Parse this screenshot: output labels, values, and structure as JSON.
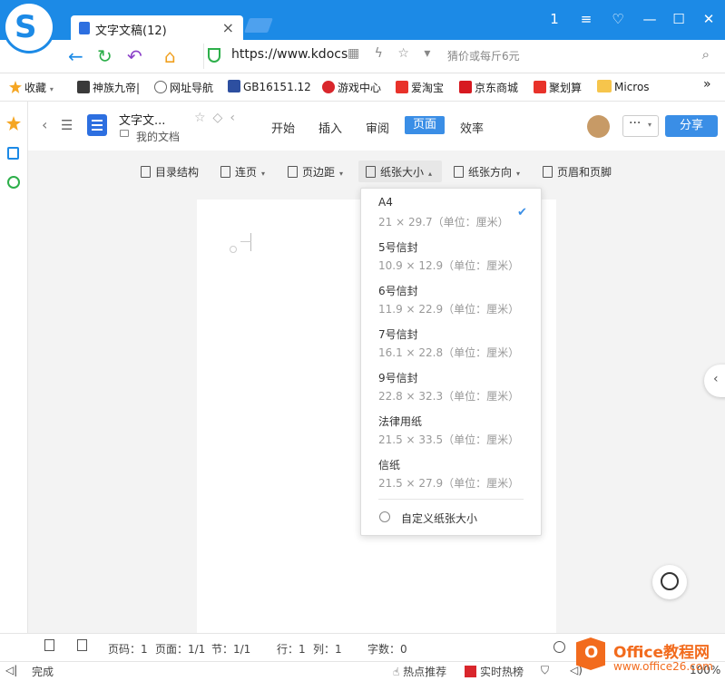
{
  "browser": {
    "tab_title": "文字文稿(12)",
    "tab_close": "×",
    "url": "https://www.kdocs",
    "search_placeholder": "猜价或每斤6元",
    "window_controls": [
      "1",
      "≡",
      "♡",
      "—",
      "☐",
      "✕"
    ],
    "nav_icons": [
      "back-icon",
      "refresh-icon",
      "undo-icon",
      "home-icon"
    ]
  },
  "bookmarks": [
    {
      "label": "收藏",
      "icon": "star-icon",
      "color": "#f5a623"
    },
    {
      "label": "神族九帝|",
      "icon": "game-icon",
      "color": "#3a3a3a"
    },
    {
      "label": "网址导航",
      "icon": "globe-icon",
      "color": "#666666"
    },
    {
      "label": "GB16151.12",
      "icon": "a-icon",
      "color": "#2d4fa0"
    },
    {
      "label": "游戏中心",
      "icon": "game-center-icon",
      "color": "#d9262c"
    },
    {
      "label": "爱淘宝",
      "icon": "taobao-icon",
      "color": "#e8322a"
    },
    {
      "label": "京东商城",
      "icon": "jd-icon",
      "color": "#d71920"
    },
    {
      "label": "聚划算",
      "icon": "juhuasuan-icon",
      "color": "#e8322a"
    },
    {
      "label": "Micros",
      "icon": "folder-icon",
      "color": "#f6c54c"
    }
  ],
  "doc": {
    "title": "文字文...",
    "folder": "我的文档",
    "menu": [
      "开始",
      "插入",
      "审阅",
      "页面",
      "效率"
    ],
    "active_menu": "页面",
    "more": "···",
    "share": "分享"
  },
  "toolbar": [
    {
      "label": "目录结构",
      "caret": false
    },
    {
      "label": "连页",
      "caret": true
    },
    {
      "label": "页边距",
      "caret": true
    },
    {
      "label": "纸张大小",
      "caret": true,
      "active": true
    },
    {
      "label": "纸张方向",
      "caret": true
    },
    {
      "label": "页眉和页脚",
      "caret": false
    }
  ],
  "paper_sizes": [
    {
      "name": "A4",
      "size": "21 × 29.7（单位：厘米）",
      "selected": true
    },
    {
      "name": "5号信封",
      "size": "10.9 × 12.9（单位：厘米）"
    },
    {
      "name": "6号信封",
      "size": "11.9 × 22.9（单位：厘米）"
    },
    {
      "name": "7号信封",
      "size": "16.1 × 22.8（单位：厘米）"
    },
    {
      "name": "9号信封",
      "size": "22.8 × 32.3（单位：厘米）"
    },
    {
      "name": "法律用纸",
      "size": "21.5 × 33.5（单位：厘米）"
    },
    {
      "name": "信纸",
      "size": "21.5 × 27.9（单位：厘米）"
    }
  ],
  "custom_size": "自定义纸张大小",
  "status": {
    "page_num": "页码：1",
    "pages": "页面：1/1",
    "section": "节：1/1",
    "row": "行：1",
    "col": "列：1",
    "words": "字数：0"
  },
  "bottom": {
    "done": "完成",
    "hot": "热点推荐",
    "realtime": "实时热榜",
    "zoom": "100%"
  },
  "watermark": {
    "logo": "O",
    "brand": "Office教程网",
    "site": "www.office26.com"
  }
}
